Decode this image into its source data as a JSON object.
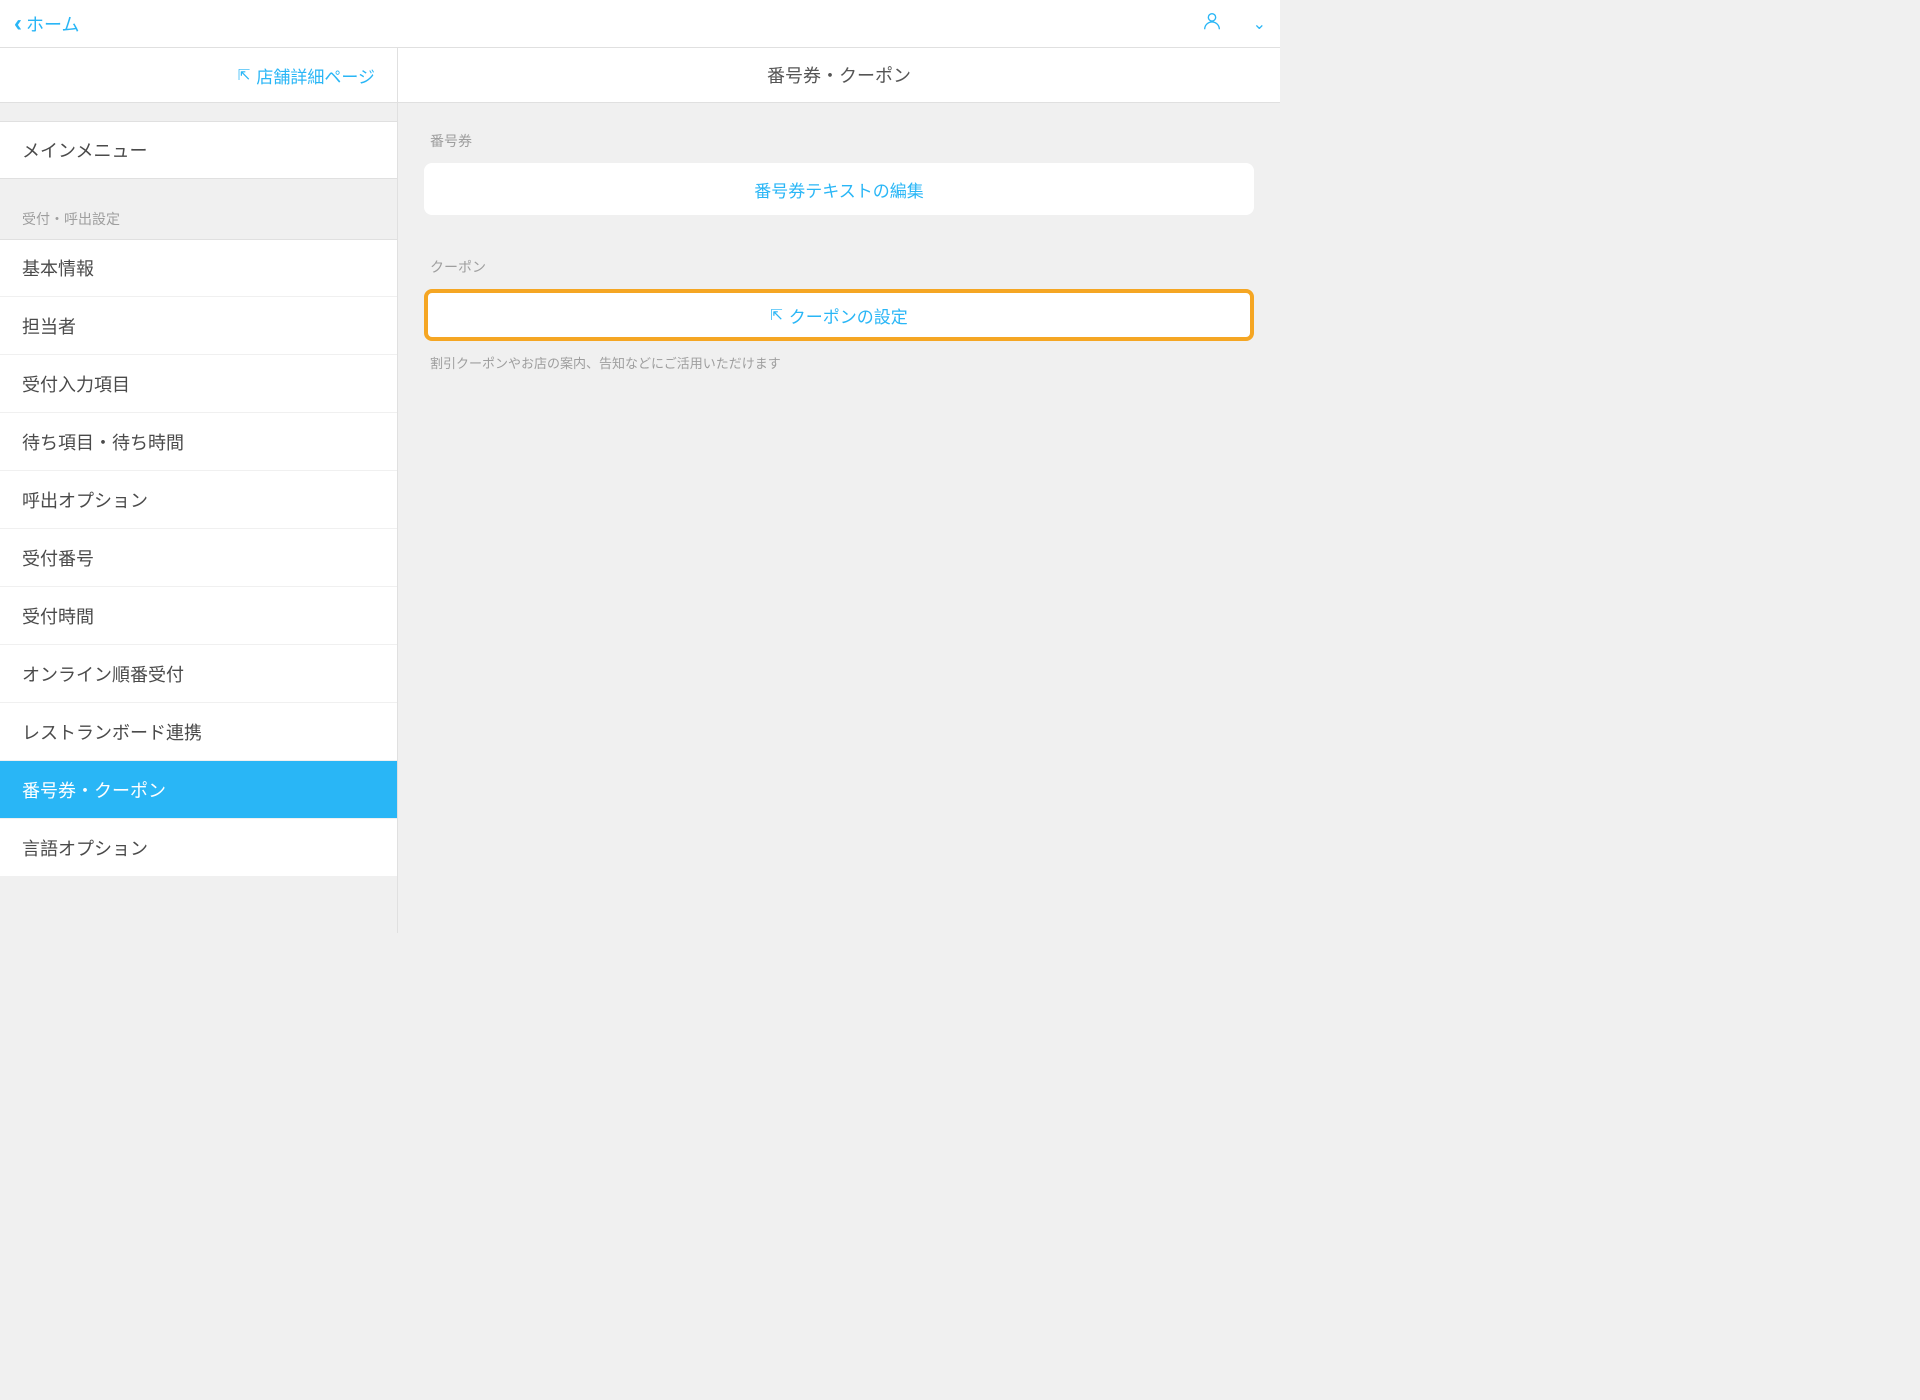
{
  "header": {
    "back_label": "ホーム"
  },
  "sidebar": {
    "store_detail_label": "店舗詳細ページ",
    "main_menu_label": "メインメニュー",
    "section_header": "受付・呼出設定",
    "items": [
      {
        "label": "基本情報"
      },
      {
        "label": "担当者"
      },
      {
        "label": "受付入力項目"
      },
      {
        "label": "待ち項目・待ち時間"
      },
      {
        "label": "呼出オプション"
      },
      {
        "label": "受付番号"
      },
      {
        "label": "受付時間"
      },
      {
        "label": "オンライン順番受付"
      },
      {
        "label": "レストランボード連携"
      },
      {
        "label": "番号券・クーポン"
      },
      {
        "label": "言語オプション"
      }
    ]
  },
  "main": {
    "title": "番号券・クーポン",
    "group1_label": "番号券",
    "group1_action": "番号券テキストの編集",
    "group2_label": "クーポン",
    "group2_action": "クーポンの設定",
    "group2_help": "割引クーポンやお店の案内、告知などにご活用いただけます"
  }
}
